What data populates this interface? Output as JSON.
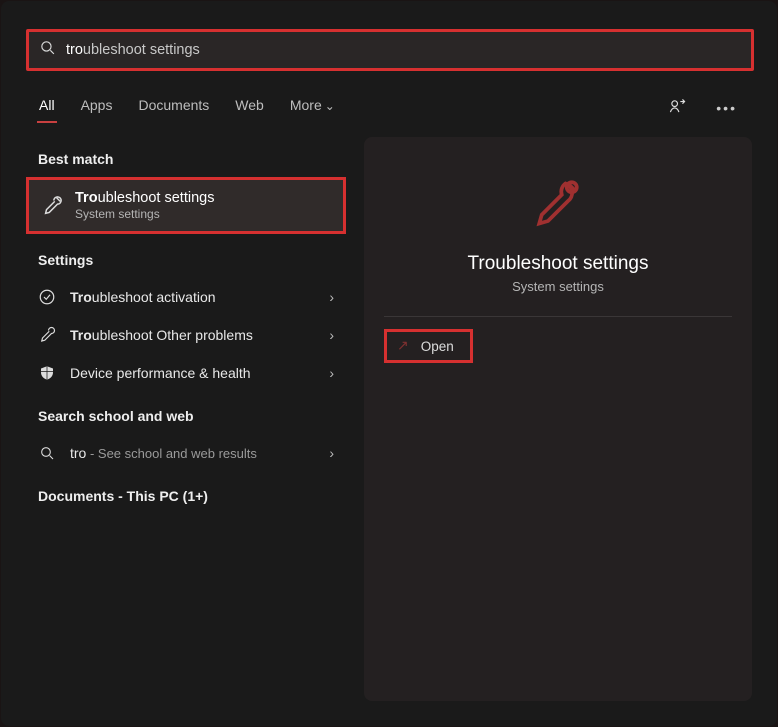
{
  "search": {
    "typed": "tro",
    "completion": "ubleshoot settings"
  },
  "tabs": {
    "items": [
      "All",
      "Apps",
      "Documents",
      "Web",
      "More"
    ],
    "active": 0
  },
  "left": {
    "best_match_label": "Best match",
    "best_match": {
      "title_hl": "Tro",
      "title_rest": "ubleshoot settings",
      "subtitle": "System settings"
    },
    "settings_label": "Settings",
    "settings_items": [
      {
        "icon": "check-circle",
        "hl": "Tro",
        "rest": "ubleshoot activation"
      },
      {
        "icon": "wrench",
        "hl": "Tro",
        "rest": "ubleshoot Other problems"
      },
      {
        "icon": "shield",
        "hl": "",
        "rest": "Device performance & health"
      }
    ],
    "web_label": "Search school and web",
    "web_item": {
      "term": "tro",
      "after": " - See school and web results"
    },
    "docs_label": "Documents - This PC (1+)"
  },
  "detail": {
    "title": "Troubleshoot settings",
    "subtitle": "System settings",
    "open_label": "Open"
  }
}
